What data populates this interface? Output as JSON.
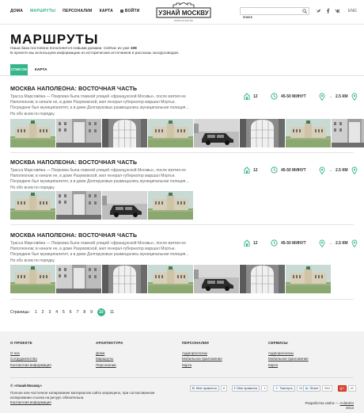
{
  "header": {
    "nav": [
      "ДОМА",
      "МАРШРУТЫ",
      "ПЕРСОНАЛИИ",
      "КАРТА"
    ],
    "active_nav": "МАРШРУТЫ",
    "login": "ВОЙТИ",
    "logo_text": "УЗНАЙ МОСКВУ",
    "logo_sub": "WWW.UZ-MO.RU",
    "search_value": "поиск",
    "lang": "ENG",
    "accent_color": "#35b58a"
  },
  "page": {
    "title": "МАРШРУТЫ",
    "intro_line1_prefix": "Наша база постоянно пополняется новыми домами. Сейчас их уже ",
    "intro_count": "198",
    "intro_line2": "В проекте мы используем информацию из исторических источников и рассказы экскурсоводов."
  },
  "tabs": {
    "list": "СПИСОК",
    "map": "КАРТА"
  },
  "routes": [
    {
      "title": "МОСКВА НАПОЛЕОНА: ВОСТОЧНАЯ ЧАСТЬ",
      "desc": "Трасса Марсовёжа — Покровка была главной улицей «французской Москвы», после взятия ее Наполеоном; в начале ее, в доме Разумовской, жил генерал-губернатор маршал Мортье. Посредине был муниципалитет, а в доме Долгоруковых размещались муниципальная полиция… Но обо всем по порядку.",
      "houses": "12",
      "duration": "45-50 МИНУТ",
      "distance": "2.5 КМ"
    },
    {
      "title": "МОСКВА НАПОЛЕОНА: ВОСТОЧНАЯ ЧАСТЬ",
      "desc": "Трасса Марсовёжа — Покровка была главной улицей «французской Москвы», после взятия ее Наполеоном; в начале ее, в доме Разумовской, жил генерал-губернатор маршал Мортье. Посредине был муниципалитет, а в доме Долгоруковых размещались муниципальная полиция… Но обо всем по порядку.",
      "houses": "12",
      "duration": "45-50 МИНУТ",
      "distance": "2.5 КМ"
    },
    {
      "title": "МОСКВА НАПОЛЕОНА: ВОСТОЧНАЯ ЧАСТЬ",
      "desc": "Трасса Марсовёжа — Покровка была главной улицей «французской Москвы», после взятия ее Наполеоном; в начале ее, в доме Разумовской, жил генерал-губернатор маршал Мортье. Посредине был муниципалитет, а в доме Долгоруковых размещались муниципальная полиция… Но обо всем по порядку.",
      "houses": "12",
      "duration": "45-50 МИНУТ",
      "distance": "2.5 КМ"
    }
  ],
  "pagination": {
    "label": "Страницы:",
    "pages": [
      "1",
      "2",
      "3",
      "4",
      "5",
      "6",
      "7",
      "8",
      "9",
      "10",
      "11"
    ],
    "current": "10"
  },
  "footer": {
    "cols": [
      {
        "heading": "О ПРОЕКТЕ",
        "links": [
          "О нас",
          "Сотрудничество",
          "Контактная информация"
        ]
      },
      {
        "heading": "АРХИТЕКТУРА",
        "links": [
          "Дома",
          "Маршруты",
          "Персоналии"
        ]
      },
      {
        "heading": "ПЕРСОНАЛИИ",
        "links": [
          "Аудиорассказы",
          "Мобильное приложение",
          "Карта"
        ]
      },
      {
        "heading": "СЕРВИСЫ",
        "links": [
          "Аудиорассказы",
          "Мобильное приложение",
          "Карта"
        ]
      }
    ],
    "copyright": "© «Узнай Москву»",
    "copy_text": "Полное или частичное копирование материалов сайта запрещено, при согласованном копировании ссылка на ресурс обязательна.",
    "contact_link": "Контактная информация",
    "share": {
      "vk_label": "Мне нравится",
      "vk_count": "8",
      "fb_label": "Мне нравится",
      "fb_count": "1",
      "tw_label": "Твитнуть",
      "tw_count": "93",
      "li_label": "Share",
      "li_count": "664",
      "gp_count": "41"
    },
    "developer_prefix": "Разработка сайта — ",
    "developer_link": "Aclantrio",
    "year": "2013"
  }
}
